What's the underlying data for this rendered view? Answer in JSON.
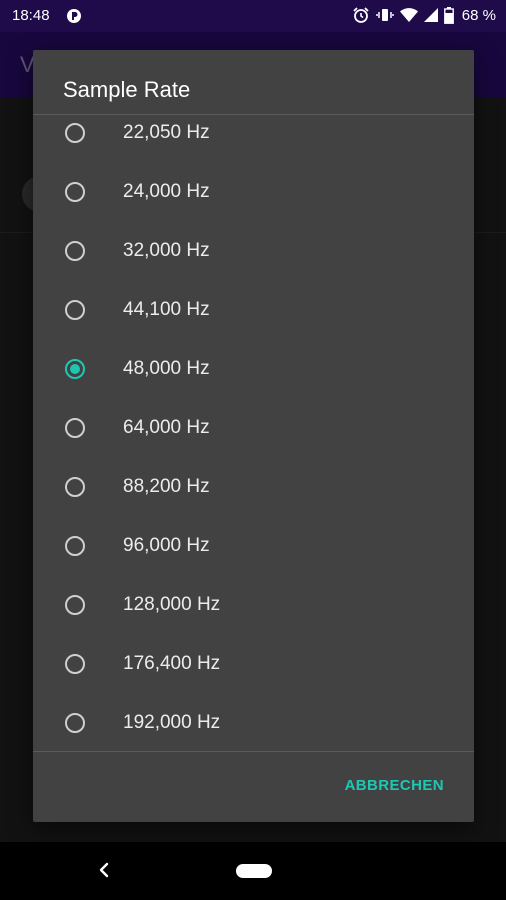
{
  "status_bar": {
    "time": "18:48",
    "left_icons": [
      "app-notification-icon"
    ],
    "right_icons": [
      "alarm-icon",
      "vibrate-icon",
      "wifi-icon",
      "cell-signal-icon",
      "battery-icon"
    ],
    "battery_text": "68 %"
  },
  "background": {
    "app_title_fragment": "V"
  },
  "dialog": {
    "title": "Sample Rate",
    "options": [
      {
        "label": "22,050 Hz",
        "checked": false
      },
      {
        "label": "24,000 Hz",
        "checked": false
      },
      {
        "label": "32,000 Hz",
        "checked": false
      },
      {
        "label": "44,100 Hz",
        "checked": false
      },
      {
        "label": "48,000 Hz",
        "checked": true
      },
      {
        "label": "64,000 Hz",
        "checked": false
      },
      {
        "label": "88,200 Hz",
        "checked": false
      },
      {
        "label": "96,000 Hz",
        "checked": false
      },
      {
        "label": "128,000 Hz",
        "checked": false
      },
      {
        "label": "176,400 Hz",
        "checked": false
      },
      {
        "label": "192,000 Hz",
        "checked": false
      }
    ],
    "cancel_label": "ABBRECHEN"
  },
  "colors": {
    "accent": "#1dc8b3",
    "dialog_bg": "#424242",
    "app_bar": "#2b0d72"
  }
}
